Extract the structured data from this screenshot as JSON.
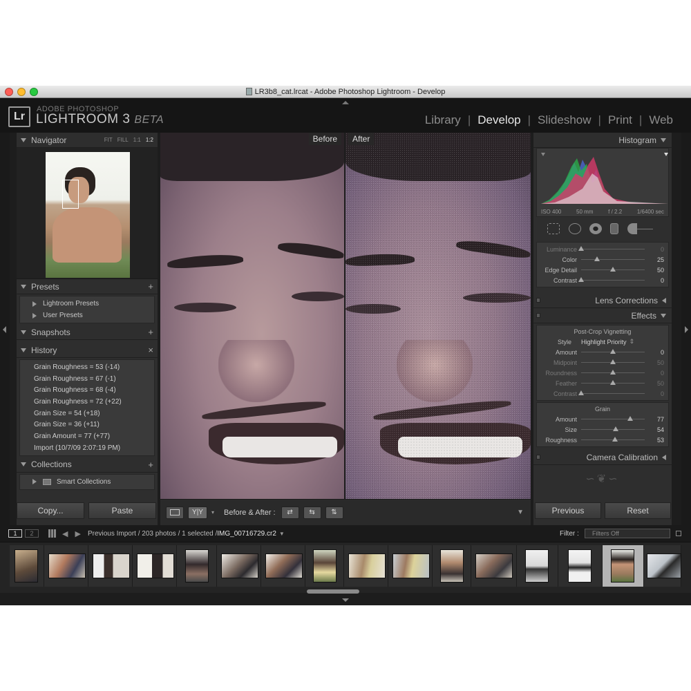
{
  "window": {
    "title": "LR3b8_cat.lrcat - Adobe Photoshop Lightroom - Develop"
  },
  "brand": {
    "line1": "ADOBE PHOTOSHOP",
    "line2": "LIGHTROOM 3",
    "beta": "BETA",
    "logo": "Lr"
  },
  "modules": [
    "Library",
    "Develop",
    "Slideshow",
    "Print",
    "Web"
  ],
  "active_module": "Develop",
  "left": {
    "navigator": {
      "title": "Navigator",
      "opts": [
        "FIT",
        "FILL",
        "1:1",
        "1:2"
      ],
      "active_opt": "1:2"
    },
    "presets": {
      "title": "Presets",
      "items": [
        "Lightroom Presets",
        "User Presets"
      ]
    },
    "snapshots": {
      "title": "Snapshots"
    },
    "history": {
      "title": "History",
      "items": [
        "Grain Roughness = 53 (-14)",
        "Grain Roughness = 67 (-1)",
        "Grain Roughness = 68 (-4)",
        "Grain Roughness = 72 (+22)",
        "Grain Size = 54 (+18)",
        "Grain Size = 36 (+11)",
        "Grain Amount = 77 (+77)",
        "Import (10/7/09 2:07:19 PM)"
      ]
    },
    "collections": {
      "title": "Collections",
      "items": [
        "Smart Collections"
      ]
    },
    "buttons": {
      "copy": "Copy...",
      "paste": "Paste"
    }
  },
  "view": {
    "before_label": "Before",
    "after_label": "After"
  },
  "toolbar": {
    "before_after_label": "Before & After :",
    "yy_label": "Y|Y"
  },
  "right": {
    "histogram": {
      "title": "Histogram",
      "iso": "ISO 400",
      "focal": "50 mm",
      "aperture": "f / 2.2",
      "shutter": "1/6400 sec"
    },
    "noise": [
      {
        "label": "Luminance",
        "value": "0",
        "pos": 0.0,
        "dim": true
      },
      {
        "label": "Color",
        "value": "25",
        "pos": 0.25,
        "dim": false
      },
      {
        "label": "Edge Detail",
        "value": "50",
        "pos": 0.5,
        "dim": false
      },
      {
        "label": "Contrast",
        "value": "0",
        "pos": 0.0,
        "dim": false
      }
    ],
    "lens_corrections": "Lens Corrections",
    "effects": {
      "title": "Effects",
      "vignette_title": "Post-Crop Vignetting",
      "style_label": "Style",
      "style_value": "Highlight Priority",
      "vignette": [
        {
          "label": "Amount",
          "value": "0",
          "pos": 0.5,
          "dim": false
        },
        {
          "label": "Midpoint",
          "value": "50",
          "pos": 0.5,
          "dim": true
        },
        {
          "label": "Roundness",
          "value": "0",
          "pos": 0.5,
          "dim": true
        },
        {
          "label": "Feather",
          "value": "50",
          "pos": 0.5,
          "dim": true
        },
        {
          "label": "Contrast",
          "value": "0",
          "pos": 0.0,
          "dim": true
        }
      ],
      "grain_title": "Grain",
      "grain": [
        {
          "label": "Amount",
          "value": "77",
          "pos": 0.77,
          "dim": false
        },
        {
          "label": "Size",
          "value": "54",
          "pos": 0.54,
          "dim": false
        },
        {
          "label": "Roughness",
          "value": "53",
          "pos": 0.53,
          "dim": false
        }
      ]
    },
    "camera_calibration": "Camera Calibration",
    "buttons": {
      "previous": "Previous",
      "reset": "Reset"
    }
  },
  "filmbar": {
    "screen1": "1",
    "screen2": "2",
    "source": "Previous Import / 203 photos / 1 selected / ",
    "filename": "IMG_00716729.cr2",
    "filter_label": "Filter :",
    "filter_value": "Filters Off"
  },
  "colors": {
    "accent_active": "#e8e8e8",
    "panel": "#2e2e2e",
    "background": "#1d1d1d"
  }
}
